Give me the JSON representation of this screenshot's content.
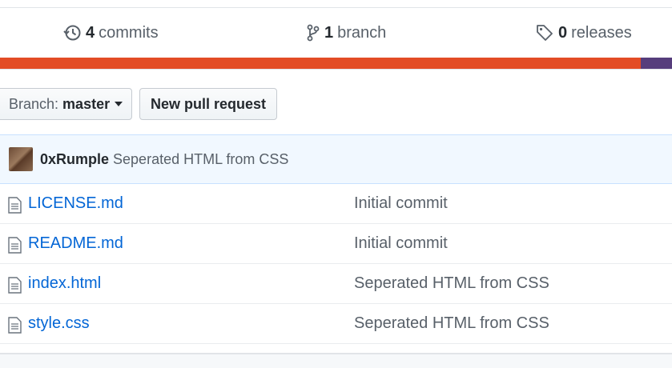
{
  "stats": {
    "commits": {
      "count": "4",
      "label": "commits",
      "icon": "history-icon"
    },
    "branches": {
      "count": "1",
      "label": "branch",
      "icon": "git-branch-icon"
    },
    "releases": {
      "count": "0",
      "label": "releases",
      "icon": "tag-icon"
    }
  },
  "language_bar": {
    "segments": [
      {
        "color": "#e34c26",
        "fraction": 0.954
      },
      {
        "color": "#563d7c",
        "fraction": 0.046
      }
    ]
  },
  "toolbar": {
    "branch_label": "Branch:",
    "branch_value": "master",
    "new_pr_label": "New pull request"
  },
  "latest_commit": {
    "author": "0xRumple",
    "message": "Seperated HTML from CSS"
  },
  "files": [
    {
      "name": "LICENSE.md",
      "message": "Initial commit",
      "icon": "file-icon"
    },
    {
      "name": "README.md",
      "message": "Initial commit",
      "icon": "file-icon"
    },
    {
      "name": "index.html",
      "message": "Seperated HTML from CSS",
      "icon": "file-icon"
    },
    {
      "name": "style.css",
      "message": "Seperated HTML from CSS",
      "icon": "file-icon"
    }
  ]
}
